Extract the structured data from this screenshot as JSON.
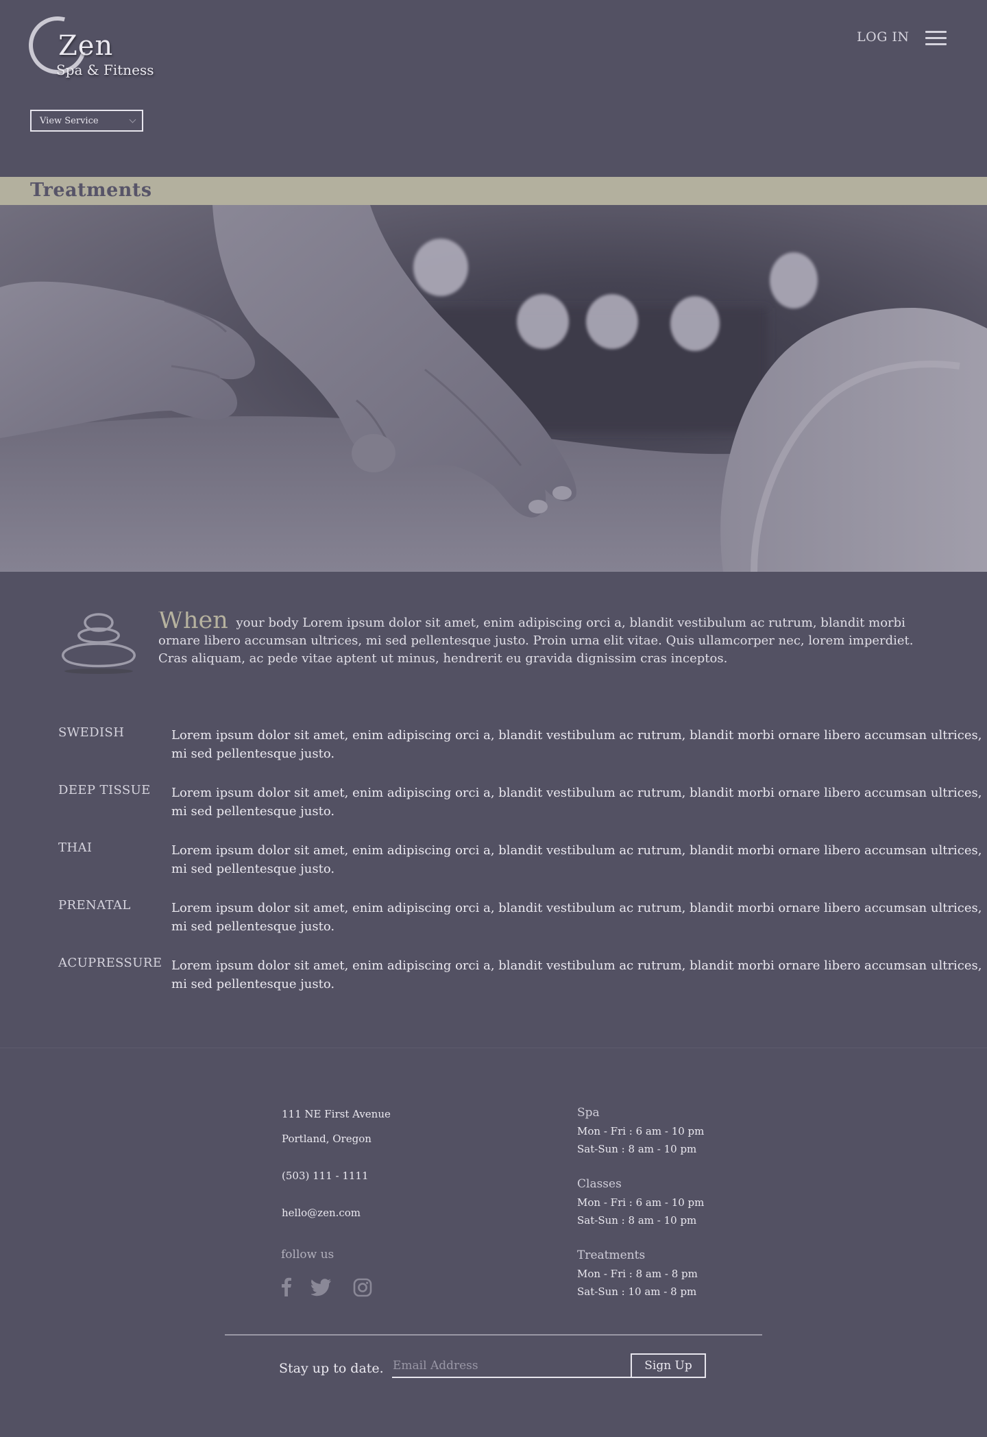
{
  "brand": {
    "name": "Zen",
    "tagline": "Spa & Fitness"
  },
  "header": {
    "login_label": "LOG IN"
  },
  "service_select": {
    "selected": "View Service"
  },
  "page": {
    "title": "Treatments"
  },
  "intro": {
    "lead": "When",
    "text": "your body Lorem ipsum dolor sit amet, enim adipiscing orci a, blandit vestibulum ac rutrum, blandit morbi ornare libero accumsan ultrices, mi sed pellentesque justo. Proin urna elit vitae. Quis ullamcorper nec, lorem imperdiet. Cras aliquam, ac pede vitae aptent ut minus, hendrerit eu gravida dignissim cras inceptos."
  },
  "treatments": [
    {
      "name": "SWEDISH",
      "description": "Lorem ipsum dolor sit amet, enim adipiscing orci a, blandit vestibulum ac rutrum, blandit morbi ornare libero accumsan ultrices, mi sed pellentesque justo."
    },
    {
      "name": "DEEP TISSUE",
      "description": "Lorem ipsum dolor sit amet, enim adipiscing orci a, blandit vestibulum ac rutrum, blandit morbi ornare libero accumsan ultrices, mi sed pellentesque justo."
    },
    {
      "name": "THAI",
      "description": "Lorem ipsum dolor sit amet, enim adipiscing orci a, blandit vestibulum ac rutrum, blandit morbi ornare libero accumsan ultrices, mi sed pellentesque justo."
    },
    {
      "name": "PRENATAL",
      "description": "Lorem ipsum dolor sit amet, enim adipiscing orci a, blandit vestibulum ac rutrum, blandit morbi ornare libero accumsan ultrices, mi sed pellentesque justo."
    },
    {
      "name": "ACUPRESSURE",
      "description": "Lorem ipsum dolor sit amet, enim adipiscing orci a, blandit vestibulum ac rutrum, blandit morbi ornare libero accumsan ultrices, mi sed pellentesque justo."
    }
  ],
  "footer": {
    "address_line1": "111 NE First Avenue",
    "address_line2": "Portland, Oregon",
    "phone": "(503) 111 - 1111",
    "email": "hello@zen.com",
    "follow_label": "follow us",
    "social_icons": [
      "facebook-icon",
      "twitter-icon",
      "instagram-icon"
    ],
    "hours": {
      "spa": {
        "title": "Spa",
        "weekday": "Mon - Fri :  6 am - 10 pm",
        "weekend": "Sat-Sun : 8 am - 10 pm"
      },
      "classes": {
        "title": "Classes",
        "weekday": "Mon - Fri :  6 am - 10 pm",
        "weekend": "Sat-Sun :  8 am - 10 pm"
      },
      "treatments": {
        "title": "Treatments",
        "weekday": "Mon - Fri :  8 am - 8 pm",
        "weekend": "Sat-Sun :  10 am - 8 pm"
      }
    },
    "newsletter": {
      "label": "Stay up to date.",
      "placeholder": "Email Address",
      "button": "Sign Up"
    }
  },
  "colors": {
    "background": "#535163",
    "accent": "#b3b09e",
    "text": "#ebe9f0"
  }
}
